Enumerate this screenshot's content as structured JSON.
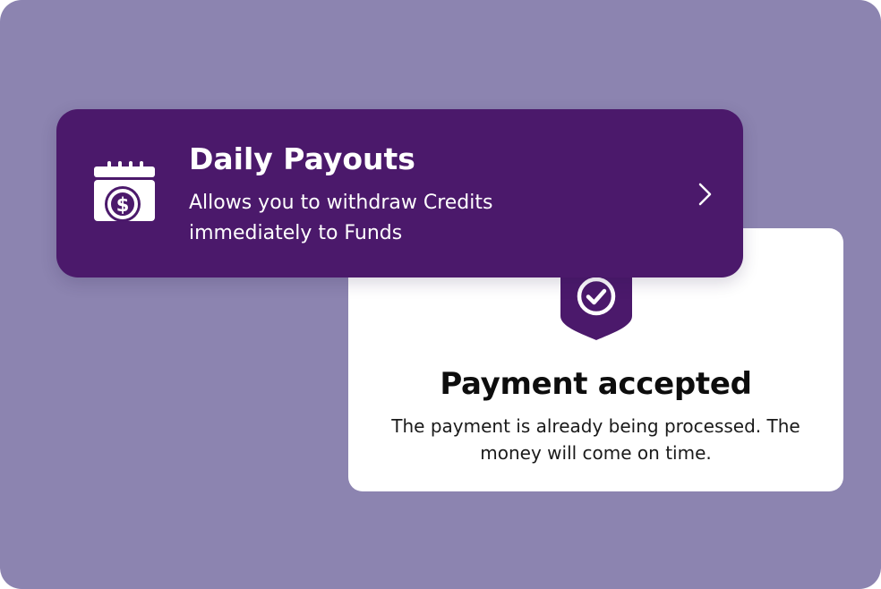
{
  "colors": {
    "background": "#8c84b0",
    "payout_card": "#4b196b",
    "payment_card": "#ffffff",
    "shield": "#4b196b"
  },
  "payout": {
    "title": "Daily Payouts",
    "description": "Allows you to withdraw Credits immediately to Funds",
    "icon": "calendar-dollar-icon",
    "action_icon": "chevron-right-icon"
  },
  "payment": {
    "title": "Payment accepted",
    "description": "The payment is already being processed. The money will come on time.",
    "icon": "check-circle-icon"
  }
}
